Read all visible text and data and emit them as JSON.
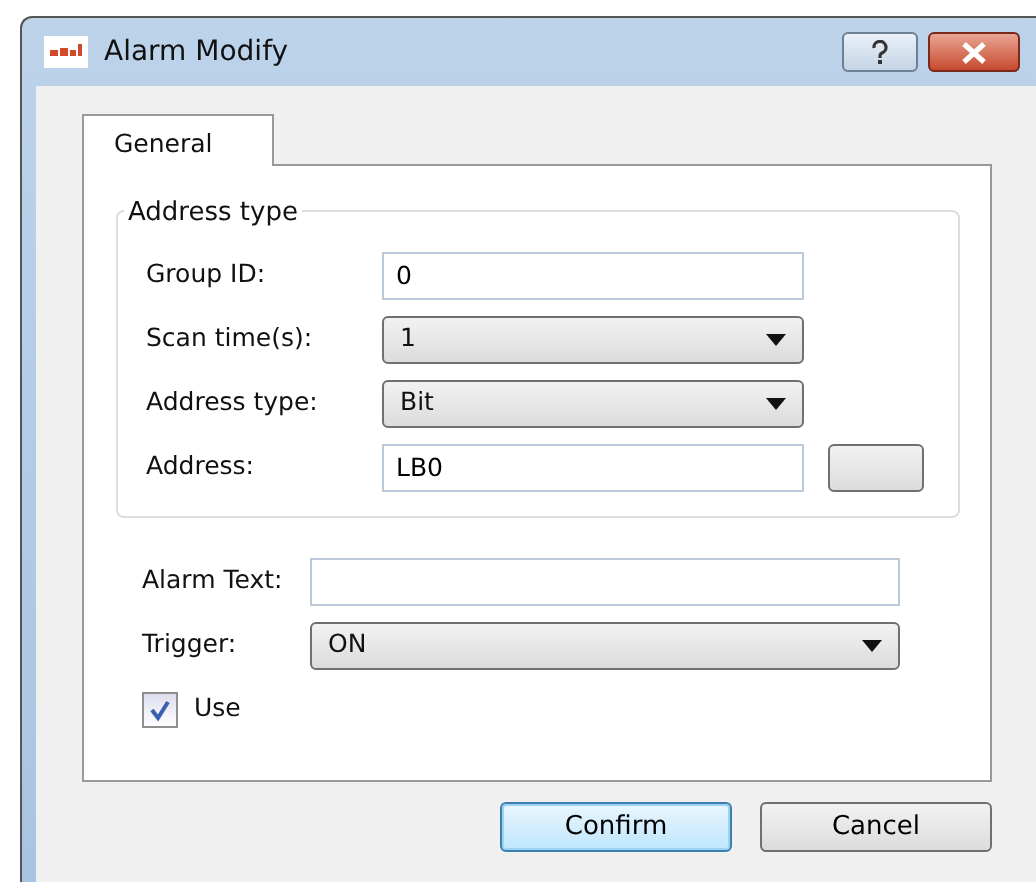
{
  "window": {
    "title": "Alarm Modify"
  },
  "tabs": [
    {
      "label": "General",
      "selected": true
    }
  ],
  "address_group": {
    "title": "Address type",
    "fields": [
      {
        "kind": "text",
        "label": "Group ID:",
        "value": "0"
      },
      {
        "kind": "select",
        "label": "Scan time(s):",
        "value": "1"
      },
      {
        "kind": "select",
        "label": "Address type:",
        "value": "Bit"
      },
      {
        "kind": "address",
        "label": "Address:",
        "value": "LB0"
      }
    ]
  },
  "fields": [
    {
      "kind": "text",
      "label": "Alarm Text:"
    },
    {
      "kind": "select",
      "label": "Trigger:",
      "value": "ON"
    }
  ],
  "use": {
    "label": "Use",
    "checked": true
  },
  "buttons": [
    {
      "label": "Confirm",
      "default": true
    },
    {
      "label": "Cancel",
      "default": false
    }
  ]
}
